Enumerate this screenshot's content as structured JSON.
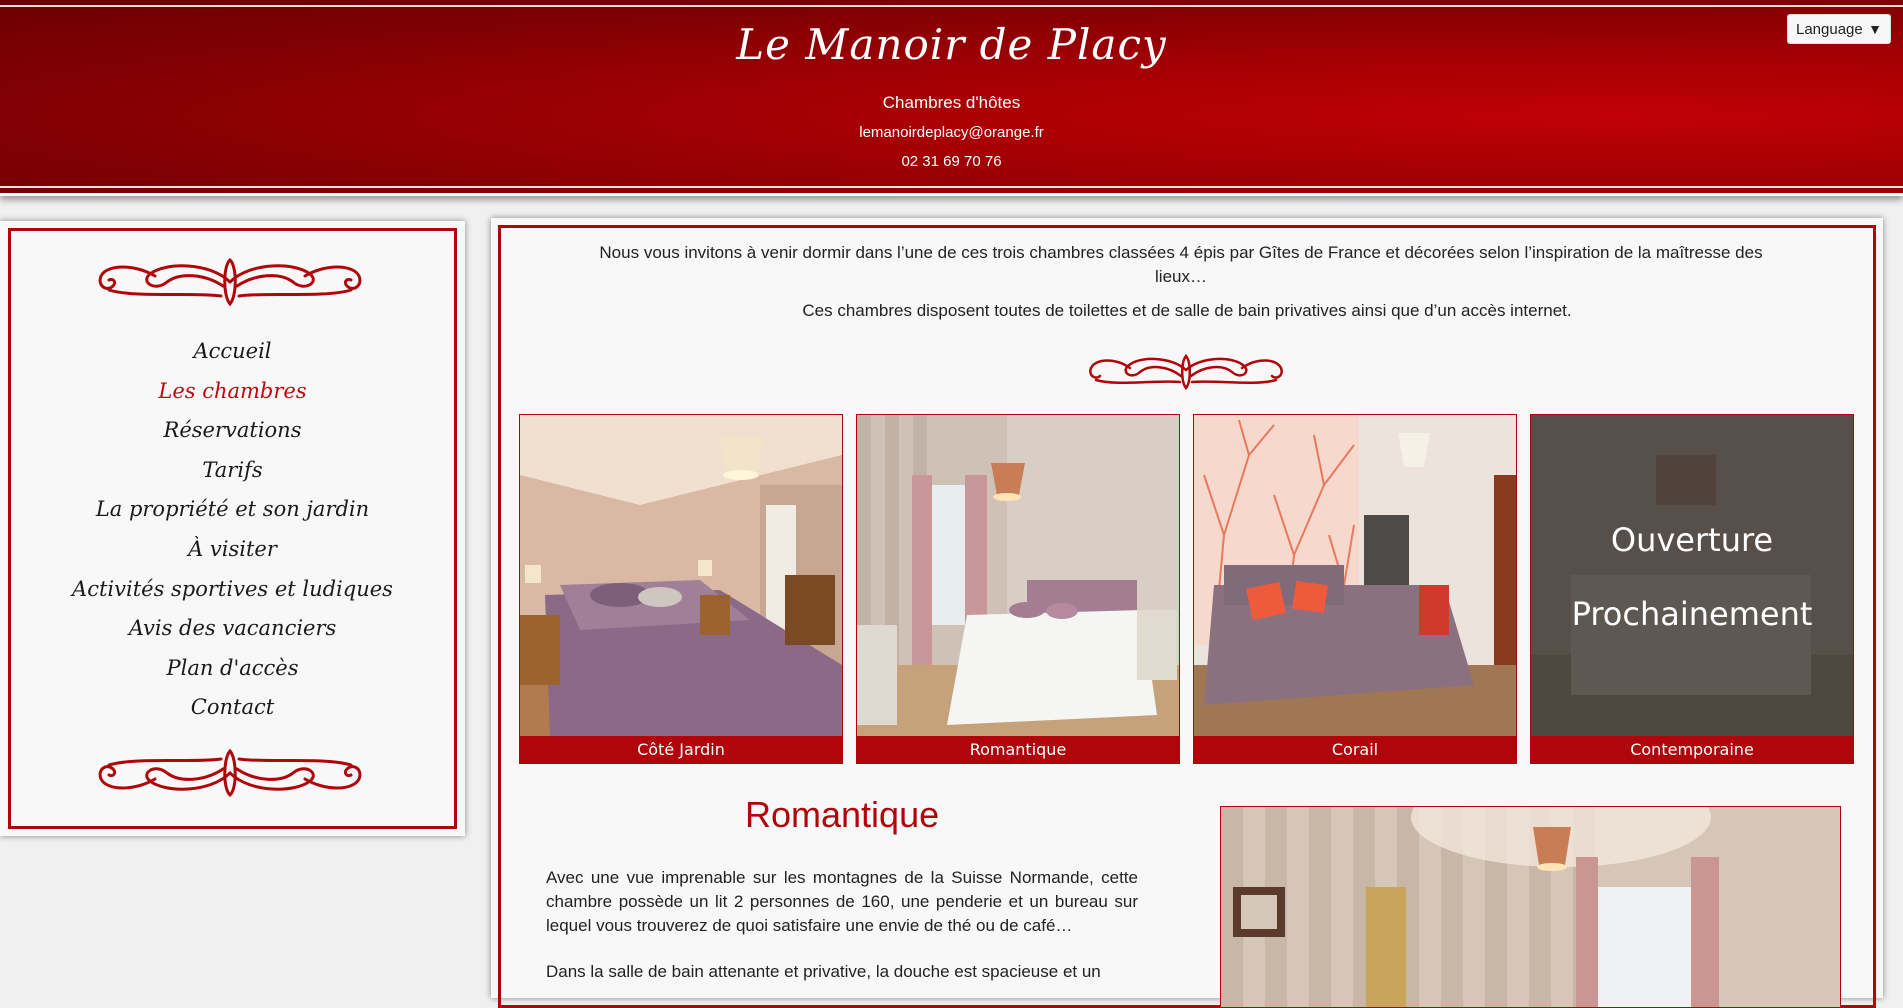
{
  "header": {
    "site_title": "Le Manoir de Placy",
    "subtitle": "Chambres d'hôtes",
    "email": "lemanoirdeplacy@orange.fr",
    "phone": "02 31 69 70 76",
    "language_label": "Language",
    "language_arrow": "▼"
  },
  "nav": {
    "items": [
      {
        "label": "Accueil"
      },
      {
        "label": "Les chambres"
      },
      {
        "label": "Réservations"
      },
      {
        "label": "Tarifs"
      },
      {
        "label": "La propriété et son jardin"
      },
      {
        "label": "À visiter"
      },
      {
        "label": "Activités sportives et ludiques"
      },
      {
        "label": "Avis des vacanciers"
      },
      {
        "label": "Plan d'accès"
      },
      {
        "label": "Contact"
      }
    ],
    "active_index": 1
  },
  "main": {
    "intro1": "Nous vous invitons à venir dormir dans l’une de ces trois chambres classées 4 épis par Gîtes de France et décorées selon l’inspiration de la maîtresse des lieux…",
    "intro2": "Ces chambres disposent toutes de toilettes et de salle de bain privatives ainsi que d’un accès internet.",
    "rooms": [
      {
        "name": "Côté Jardin"
      },
      {
        "name": "Romantique"
      },
      {
        "name": "Corail"
      },
      {
        "name": "Contemporaine",
        "overlay_line1": "Ouverture",
        "overlay_line2": "Prochainement"
      }
    ],
    "room_title": "Romantique",
    "room_desc1": "Avec une vue imprenable sur les montagnes de la Suisse Normande, cette chambre possède un lit 2 personnes de 160, une penderie et un bureau sur lequel vous trouverez de quoi satisfaire une envie de thé ou de café…",
    "room_desc2": "Dans la salle de bain attenante et privative, la douche est spacieuse et un"
  },
  "colors": {
    "brand_red": "#b0060b",
    "header_dark": "#6a0002",
    "header_light": "#c00006"
  }
}
